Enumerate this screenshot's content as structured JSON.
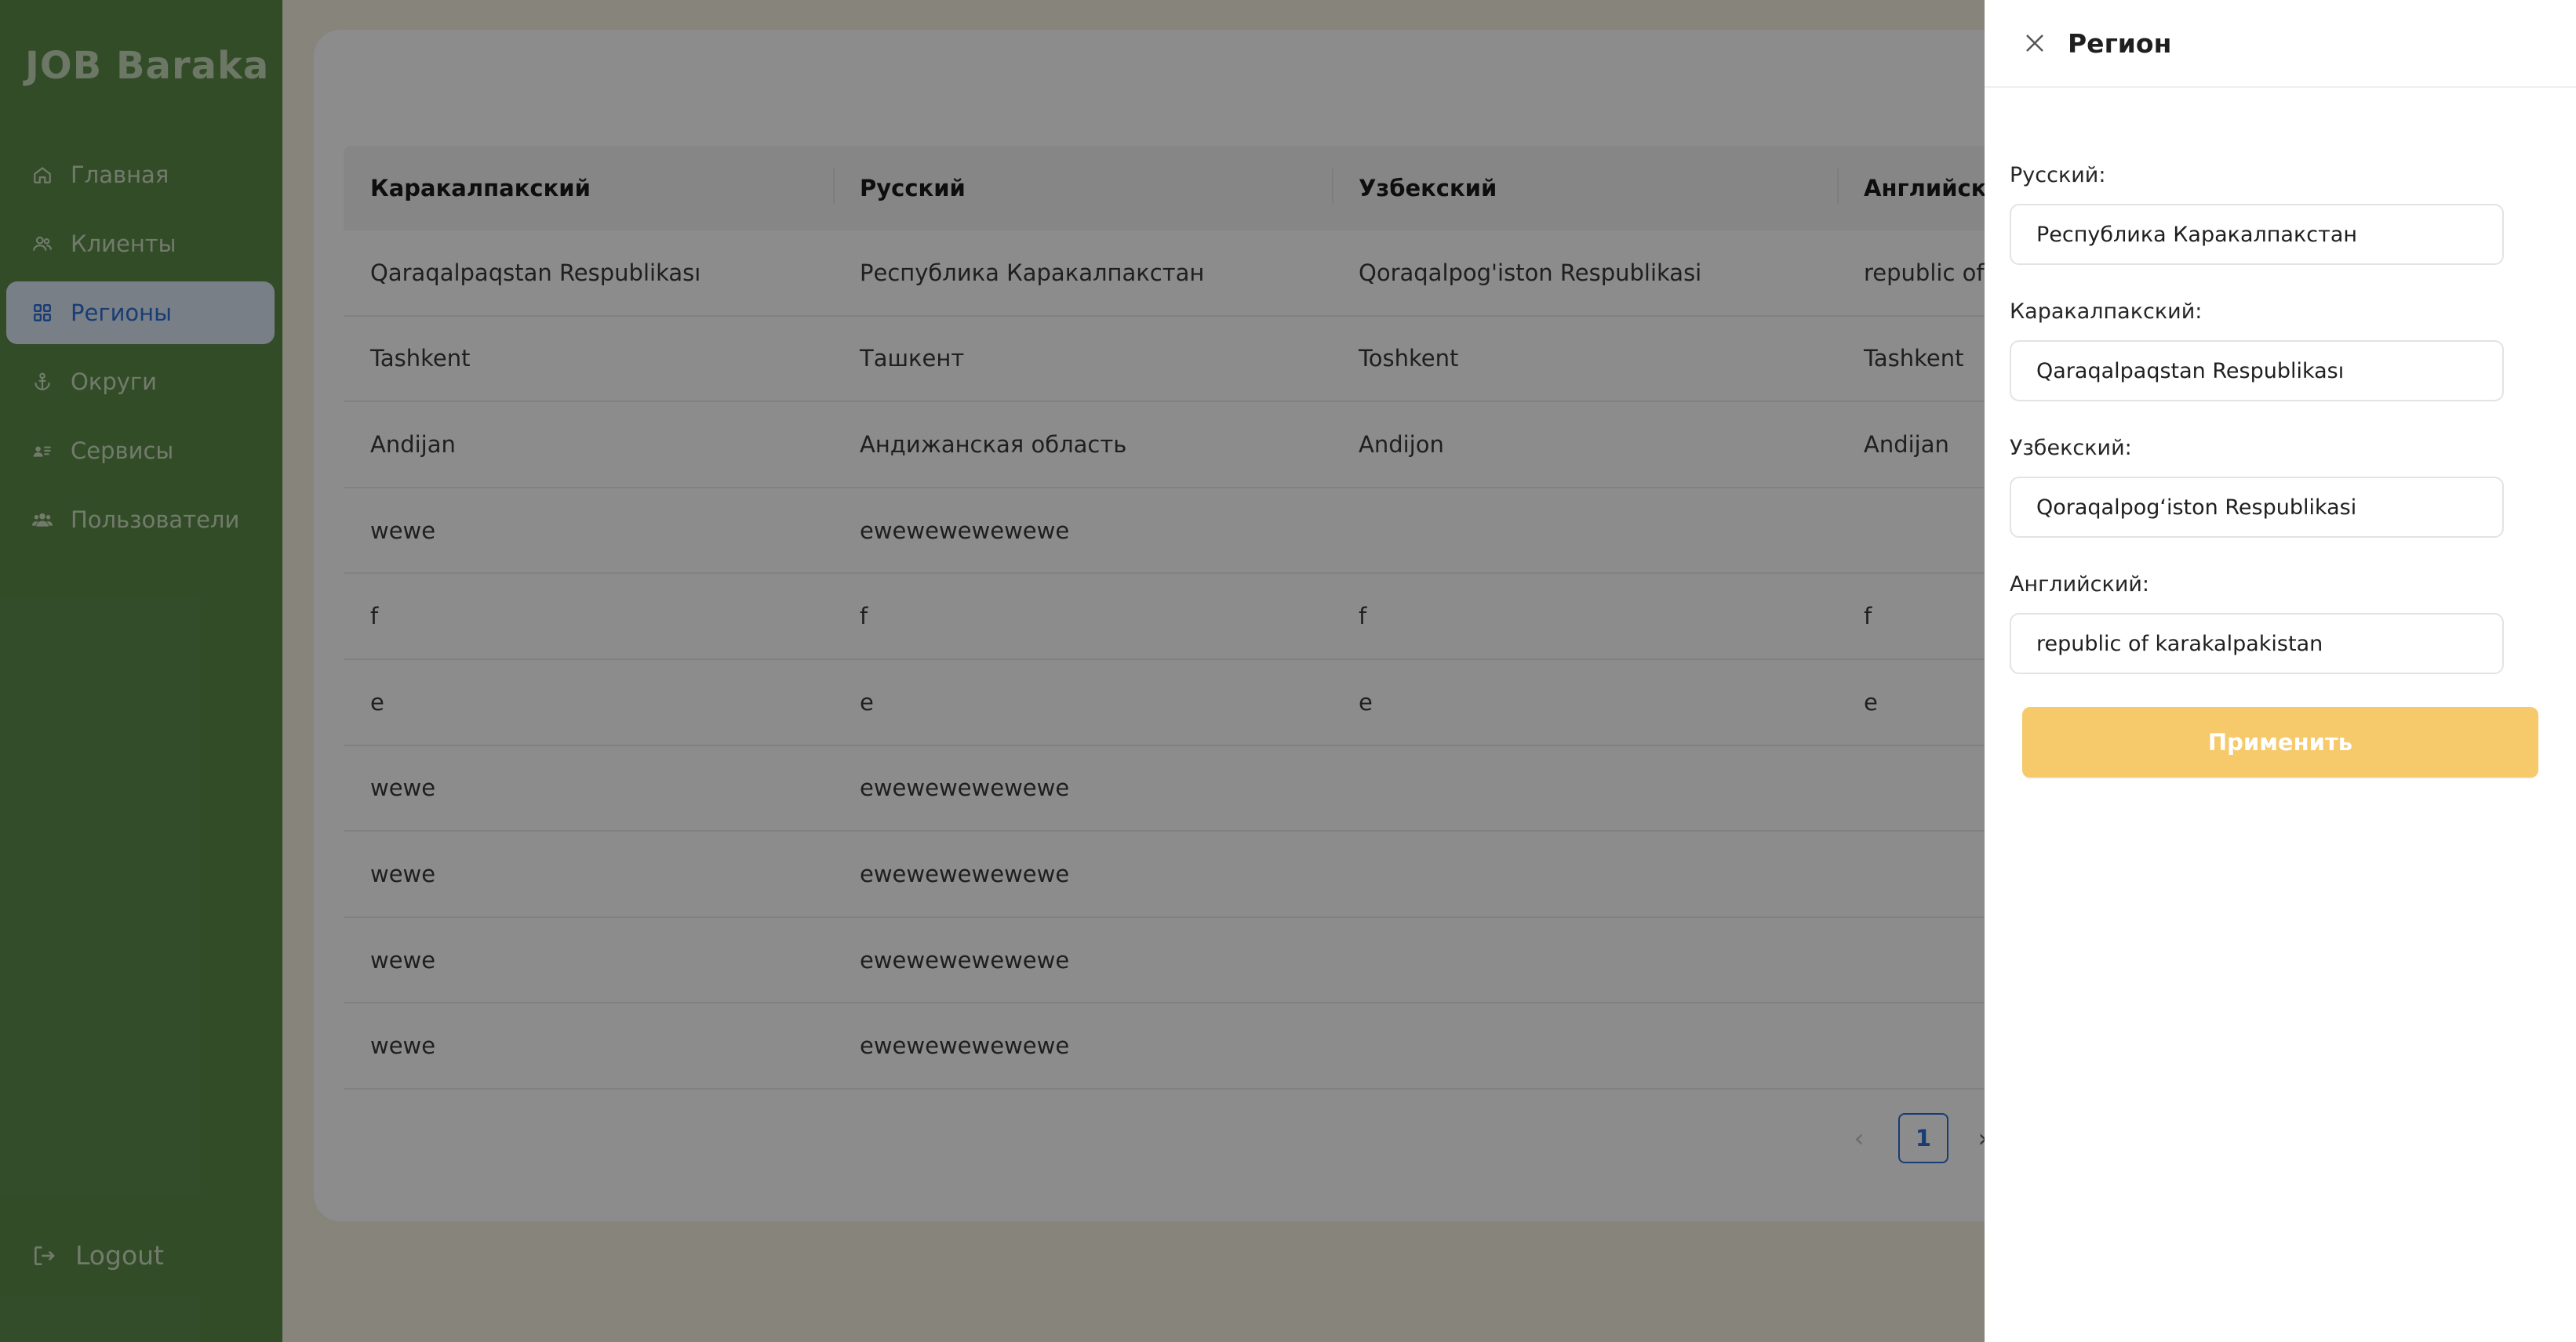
{
  "app": {
    "brand": "JOB Baraka"
  },
  "sidebar": {
    "items": [
      {
        "label": "Главная",
        "icon": "home-icon",
        "active": false
      },
      {
        "label": "Клиенты",
        "icon": "users-icon",
        "active": false
      },
      {
        "label": "Регионы",
        "icon": "grid-icon",
        "active": true
      },
      {
        "label": "Округи",
        "icon": "anchor-icon",
        "active": false
      },
      {
        "label": "Сервисы",
        "icon": "id-card-icon",
        "active": false
      },
      {
        "label": "Пользователи",
        "icon": "team-icon",
        "active": false
      }
    ],
    "logout_label": "Logout"
  },
  "table": {
    "headers": [
      "Каракалпакский",
      "Русский",
      "Узбекский",
      "Английск"
    ],
    "rows": [
      [
        "Qaraqalpaqstan Respublikası",
        "Республика Каракалпакстан",
        "Qoraqalpog'iston Respublikasi",
        "republic of"
      ],
      [
        "Tashkent",
        "Ташкент",
        "Toshkent",
        "Tashkent"
      ],
      [
        "Andijan",
        "Андижанская область",
        "Andijon",
        "Andijan"
      ],
      [
        "wewe",
        "ewewewewewewe",
        "",
        ""
      ],
      [
        "f",
        "f",
        "f",
        "f"
      ],
      [
        "e",
        "e",
        "e",
        "e"
      ],
      [
        "wewe",
        "ewewewewewewe",
        "",
        ""
      ],
      [
        "wewe",
        "ewewewewewewe",
        "",
        ""
      ],
      [
        "wewe",
        "ewewewewewewe",
        "",
        ""
      ],
      [
        "wewe",
        "ewewewewewewe",
        "",
        ""
      ]
    ]
  },
  "pagination": {
    "prev": "‹",
    "current": "1",
    "next": "›"
  },
  "drawer": {
    "title": "Регион",
    "fields": [
      {
        "label": "Русский:",
        "value": "Республика Каракалпакстан"
      },
      {
        "label": "Каракалпакский:",
        "value": "Qaraqalpaqstan Respublikası"
      },
      {
        "label": "Узбекский:",
        "value": "Qoraqalpog‘iston Respublikasi"
      },
      {
        "label": "Английский:",
        "value": "republic of karakalpakistan"
      }
    ],
    "apply_label": "Применить"
  },
  "colors": {
    "sidebar": "#5d8b4a",
    "accent": "#2d6fd6",
    "apply_button": "#f6c96a",
    "page_bg": "#f5f1e1"
  }
}
